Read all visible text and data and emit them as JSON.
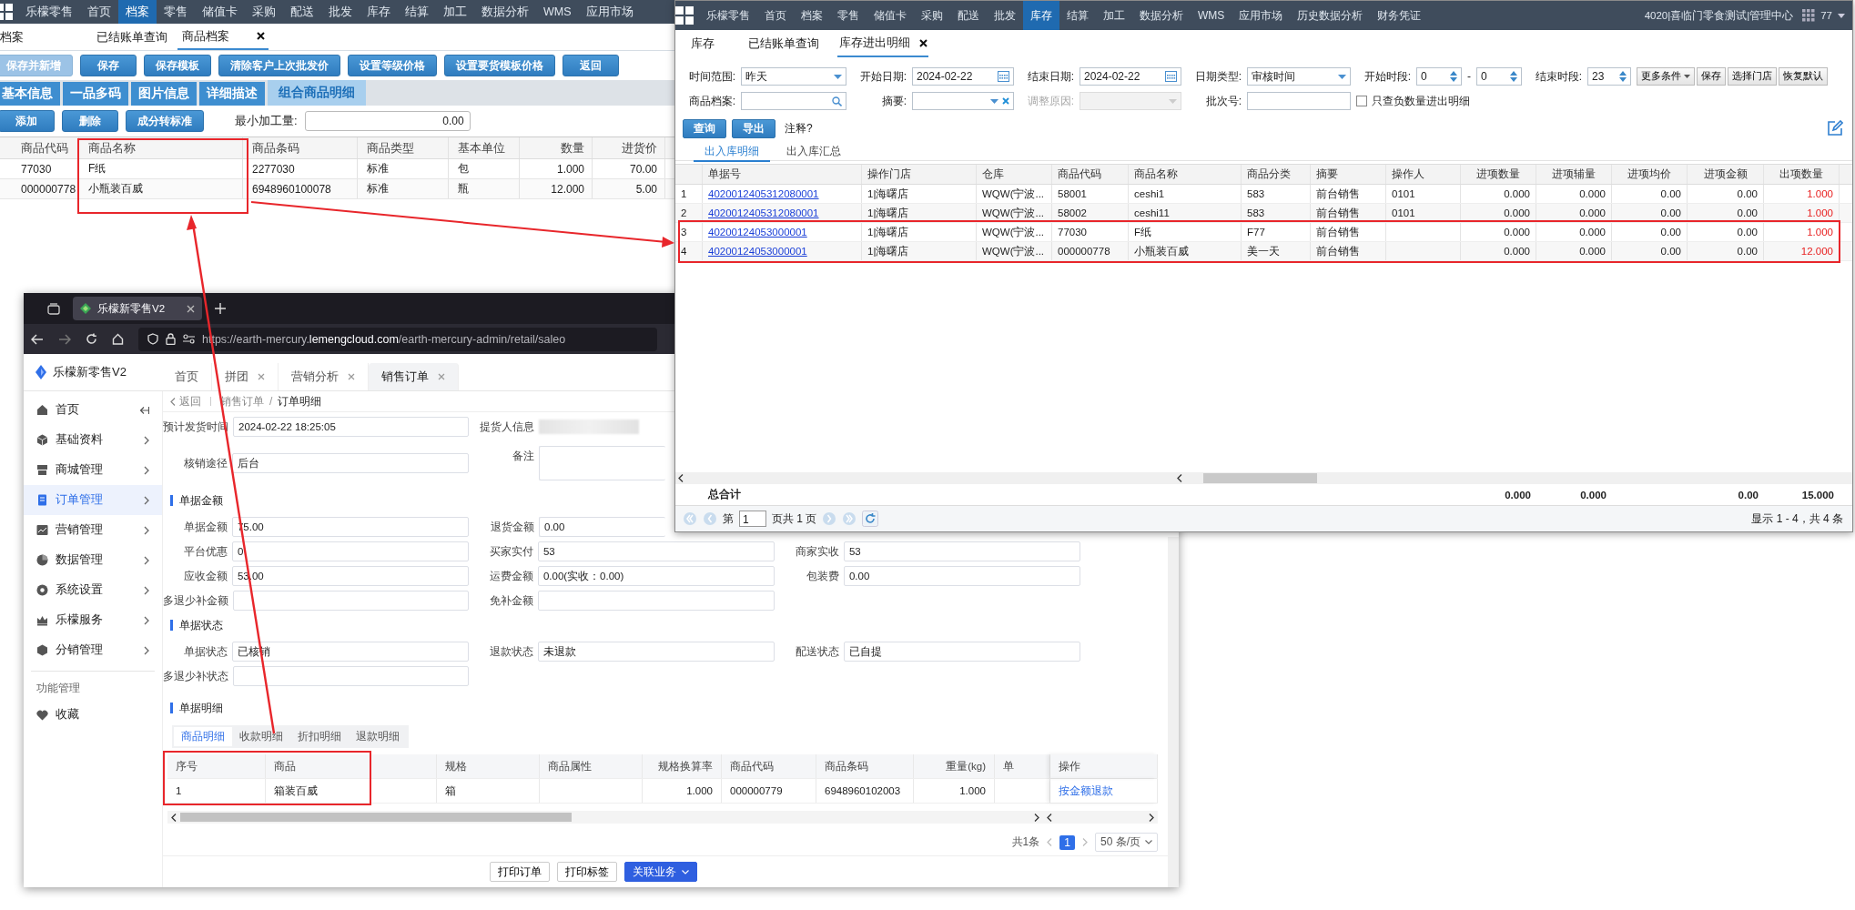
{
  "left_window": {
    "nav": [
      {
        "label": "乐檬零售",
        "selected": false
      },
      {
        "label": "首页",
        "selected": false
      },
      {
        "label": "档案",
        "selected": true
      },
      {
        "label": "零售",
        "selected": false
      },
      {
        "label": "储值卡",
        "selected": false
      },
      {
        "label": "采购",
        "selected": false
      },
      {
        "label": "配送",
        "selected": false
      },
      {
        "label": "批发",
        "selected": false
      },
      {
        "label": "库存",
        "selected": false
      },
      {
        "label": "结算",
        "selected": false
      },
      {
        "label": "加工",
        "selected": false
      },
      {
        "label": "数据分析",
        "selected": false
      },
      {
        "label": "WMS",
        "selected": false
      },
      {
        "label": "应用市场",
        "selected": false
      }
    ],
    "tabs": [
      {
        "label": "档案",
        "selected": false,
        "closable": false
      },
      {
        "label": "已结账单查询",
        "selected": false,
        "closable": false
      },
      {
        "label": "商品档案",
        "selected": true,
        "closable": true
      }
    ],
    "buttons": [
      {
        "label": "保存并新增",
        "disabled": true
      },
      {
        "label": "保存",
        "disabled": false
      },
      {
        "label": "保存模板",
        "disabled": false
      },
      {
        "label": "清除客户上次批发价",
        "disabled": false
      },
      {
        "label": "设置等级价格",
        "disabled": false
      },
      {
        "label": "设置要货模板价格",
        "disabled": false
      },
      {
        "label": "返回",
        "disabled": false
      }
    ],
    "subtabs": [
      {
        "label": "基本信息",
        "selected": false
      },
      {
        "label": "一品多码",
        "selected": false
      },
      {
        "label": "图片信息",
        "selected": false
      },
      {
        "label": "详细描述",
        "selected": false
      },
      {
        "label": "组合商品明细",
        "selected": true
      }
    ],
    "actions": [
      "添加",
      "删除",
      "成分转标准"
    ],
    "min_qty": {
      "label": "最小加工量:",
      "value": "0.00"
    },
    "table": {
      "columns": [
        "商品代码",
        "商品名称",
        "商品条码",
        "商品类型",
        "基本单位",
        "数量",
        "进货价"
      ],
      "rows": [
        [
          "77030",
          "F纸",
          "2277030",
          "标准",
          "包",
          "1.000",
          "70.00"
        ],
        [
          "000000778",
          "小瓶装百威",
          "6948960100078",
          "标准",
          "瓶",
          "12.000",
          "5.00"
        ]
      ]
    }
  },
  "right_window": {
    "nav": [
      {
        "label": "乐檬零售",
        "selected": false
      },
      {
        "label": "首页",
        "selected": false
      },
      {
        "label": "档案",
        "selected": false
      },
      {
        "label": "零售",
        "selected": false
      },
      {
        "label": "储值卡",
        "selected": false
      },
      {
        "label": "采购",
        "selected": false
      },
      {
        "label": "配送",
        "selected": false
      },
      {
        "label": "批发",
        "selected": false
      },
      {
        "label": "库存",
        "selected": true
      },
      {
        "label": "结算",
        "selected": false
      },
      {
        "label": "加工",
        "selected": false
      },
      {
        "label": "数据分析",
        "selected": false
      },
      {
        "label": "WMS",
        "selected": false
      },
      {
        "label": "应用市场",
        "selected": false
      },
      {
        "label": "历史数据分析",
        "selected": false
      },
      {
        "label": "财务凭证",
        "selected": false
      }
    ],
    "account": "4020|喜临门零食测试|管理中心",
    "user": "77",
    "tabs": [
      {
        "label": "库存",
        "selected": false,
        "closable": false
      },
      {
        "label": "已结账单查询",
        "selected": false,
        "closable": false
      },
      {
        "label": "库存进出明细",
        "selected": true,
        "closable": true
      }
    ],
    "filters": [
      {
        "kind": "select",
        "label": "时间范围:",
        "value": "昨天",
        "disabled": false
      },
      {
        "kind": "date",
        "label": "开始日期:",
        "value": "2024-02-22",
        "disabled": false
      },
      {
        "kind": "date",
        "label": "结束日期:",
        "value": "2024-02-22",
        "disabled": false
      },
      {
        "kind": "select",
        "label": "日期类型:",
        "value": "审核时间",
        "disabled": false
      },
      {
        "kind": "range",
        "label": "开始时段:",
        "from": "0",
        "separator": "-",
        "to": "0",
        "disabled": false
      },
      {
        "kind": "spin",
        "label": "结束时段:",
        "value": "23",
        "disabled": false
      },
      {
        "kind": "search",
        "label": "商品档案:",
        "disabled": false
      },
      {
        "kind": "clearable",
        "label": "摘要:",
        "disabled": false
      },
      {
        "kind": "select",
        "label": "调整原因:",
        "disabled": true
      },
      {
        "kind": "input",
        "label": "批次号:",
        "disabled": false
      },
      {
        "kind": "check",
        "label": "只查负数量进出明细",
        "checked": false
      }
    ],
    "filter_buttons": [
      {
        "label": "更多条件",
        "dropdown": true
      },
      {
        "label": "保存",
        "dropdown": false
      },
      {
        "label": "选择门店",
        "dropdown": false
      },
      {
        "label": "恢复默认",
        "dropdown": false
      }
    ],
    "query_buttons": [
      "查询",
      "导出"
    ],
    "note": "注释?",
    "subtabs": [
      {
        "label": "出入库明细",
        "selected": true
      },
      {
        "label": "出入库汇总",
        "selected": false
      }
    ],
    "table": {
      "columns": [
        "单据号",
        "操作门店",
        "仓库",
        "商品代码",
        "商品名称",
        "商品分类",
        "摘要",
        "操作人",
        "进项数量",
        "进项辅量",
        "进项均价",
        "进项金额",
        "出项数量"
      ],
      "rows": [
        {
          "number": "1",
          "cells": [
            "4020012405312080001",
            "1|海曙店",
            "WQW(宁波...",
            "58001",
            "ceshi1",
            "583",
            "前台销售",
            "0101",
            "0.000",
            "0.000",
            "0.00",
            "0.00",
            "1.000"
          ]
        },
        {
          "number": "2",
          "cells": [
            "4020012405312080001",
            "1|海曙店",
            "WQW(宁波...",
            "58002",
            "ceshi11",
            "583",
            "前台销售",
            "0101",
            "0.000",
            "0.000",
            "0.00",
            "0.00",
            "1.000"
          ]
        },
        {
          "number": "3",
          "cells": [
            "40200124053000001",
            "1|海曙店",
            "WQW(宁波...",
            "77030",
            "F纸",
            "F77",
            "前台销售",
            null,
            "0.000",
            "0.000",
            "0.00",
            "0.00",
            "1.000"
          ]
        },
        {
          "number": "4",
          "cells": [
            "40200124053000001",
            "1|海曙店",
            "WQW(宁波...",
            "000000778",
            "小瓶装百威",
            "美一天",
            "前台销售",
            null,
            "0.000",
            "0.000",
            "0.00",
            "0.00",
            "12.000"
          ]
        }
      ]
    },
    "totals": {
      "label": "总合计",
      "in_qty": "0.000",
      "in_aux": "0.000",
      "in_amount": "0.00",
      "out_qty": "15.000"
    },
    "pager": {
      "prefix": "第",
      "page": "1",
      "suffix": "页共 1 页",
      "summary": "显示 1 - 4，共 4 条"
    }
  },
  "browser_window": {
    "tab_title": "乐檬新零售V2",
    "url": {
      "scheme": "https://earth-mercury.",
      "domain": "lemengcloud.com",
      "path": "/earth-mercury-admin/retail/saleo"
    },
    "app_name": "乐檬新零售V2",
    "tabs": [
      {
        "label": "首页",
        "selected": false,
        "closable": false
      },
      {
        "label": "拼团",
        "selected": false,
        "closable": true
      },
      {
        "label": "营销分析",
        "selected": false,
        "closable": true
      },
      {
        "label": "销售订单",
        "selected": true,
        "closable": true
      }
    ],
    "sidebar": [
      {
        "label": "首页",
        "kind": "collapse",
        "selected": false
      },
      {
        "label": "基础资料",
        "kind": "group",
        "selected": false
      },
      {
        "label": "商城管理",
        "kind": "group",
        "selected": false
      },
      {
        "label": "订单管理",
        "kind": "group",
        "selected": true
      },
      {
        "label": "营销管理",
        "kind": "group",
        "selected": false
      },
      {
        "label": "数据管理",
        "kind": "group",
        "selected": false
      },
      {
        "label": "系统设置",
        "kind": "group",
        "selected": false
      },
      {
        "label": "乐檬服务",
        "kind": "group",
        "selected": false
      },
      {
        "label": "分销管理",
        "kind": "group",
        "selected": false
      }
    ],
    "sidebar_section": "功能管理",
    "favorites": "收藏",
    "breadcrumb": {
      "back": "返回",
      "path": [
        "销售订单",
        "订单明细"
      ],
      "separator": "/"
    },
    "top_rows": [
      [
        {
          "label": "预计发货时间",
          "value": "2024-02-22 18:25:05",
          "kind": "input"
        },
        {
          "label": "提货人信息",
          "kind": "redacted"
        }
      ],
      [
        {
          "label": "核销途径",
          "value": "后台",
          "kind": "input"
        },
        {
          "label": "备注",
          "kind": "textarea"
        }
      ]
    ],
    "sections": [
      {
        "title": "单据金额",
        "rows": [
          [
            {
              "label": "单据金额",
              "value": "75.00"
            },
            {
              "label": "退货金额",
              "value": "0.00"
            }
          ],
          [
            {
              "label": "平台优惠",
              "value": "0"
            },
            {
              "label": "买家实付",
              "value": "53"
            },
            {
              "label": "商家实收",
              "value": "53"
            }
          ],
          [
            {
              "label": "应收金额",
              "value": "53.00"
            },
            {
              "label": "运费金额",
              "value": "0.00(实收：0.00)"
            },
            {
              "label": "包装费",
              "value": "0.00"
            }
          ],
          [
            {
              "label": "多退少补金额"
            },
            {
              "label": "免补金额"
            }
          ]
        ]
      },
      {
        "title": "单据状态",
        "rows": [
          [
            {
              "label": "单据状态",
              "value": "已核销"
            },
            {
              "label": "退款状态",
              "value": "未退款"
            },
            {
              "label": "配送状态",
              "value": "已自提"
            }
          ],
          [
            {
              "label": "多退少补状态"
            }
          ]
        ]
      }
    ],
    "details": {
      "title": "单据明细",
      "tabs": [
        {
          "label": "商品明细",
          "selected": true
        },
        {
          "label": "收款明细",
          "selected": false
        },
        {
          "label": "折扣明细",
          "selected": false
        },
        {
          "label": "退款明细",
          "selected": false
        }
      ],
      "columns": [
        "序号",
        "商品",
        "规格",
        "商品属性",
        "规格换算率",
        "商品代码",
        "商品条码",
        "重量(kg)",
        "单",
        "操作"
      ],
      "rows": [
        {
          "cells": [
            "1",
            "箱装百威",
            "箱",
            null,
            "1.000",
            "000000779",
            "6948960102003",
            "1.000",
            null,
            "按金额退款"
          ]
        }
      ],
      "pager": {
        "total": "共1条",
        "page": "1",
        "page_size": "50 条/页"
      }
    },
    "footer_buttons": [
      {
        "label": "打印订单",
        "kind": "default"
      },
      {
        "label": "打印标签",
        "kind": "default"
      },
      {
        "label": "关联业务",
        "kind": "primary"
      }
    ]
  }
}
